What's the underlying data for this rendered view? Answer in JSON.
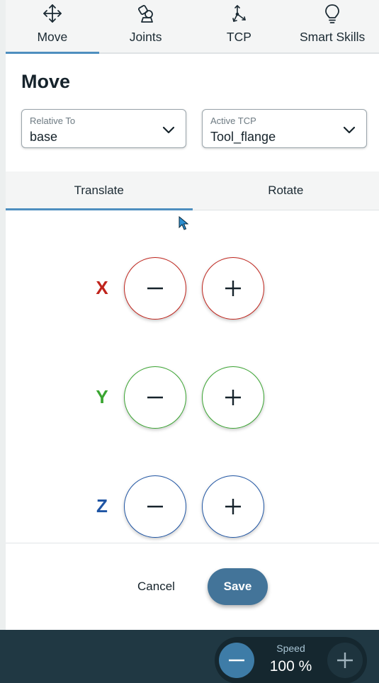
{
  "nav_tabs": [
    {
      "label": "Move",
      "icon": "move-arrows-icon",
      "active": true
    },
    {
      "label": "Joints",
      "icon": "robot-joint-icon",
      "active": false
    },
    {
      "label": "TCP",
      "icon": "tcp-axes-icon",
      "active": false
    },
    {
      "label": "Smart Skills",
      "icon": "lightbulb-icon",
      "active": false
    }
  ],
  "page": {
    "title": "Move"
  },
  "relative_to": {
    "caption": "Relative To",
    "value": "base"
  },
  "active_tcp": {
    "caption": "Active TCP",
    "value": "Tool_flange"
  },
  "mode_tabs": [
    {
      "label": "Translate",
      "active": true
    },
    {
      "label": "Rotate",
      "active": false
    }
  ],
  "axes": [
    {
      "label": "X",
      "color": "#c0241c"
    },
    {
      "label": "Y",
      "color": "#3aa531"
    },
    {
      "label": "Z",
      "color": "#1f55a4"
    }
  ],
  "actions": {
    "cancel_label": "Cancel",
    "save_label": "Save"
  },
  "speed": {
    "caption": "Speed",
    "value": "100 %"
  },
  "colors": {
    "accent": "#4e8fbf",
    "save_button": "#437499",
    "bottom_bar": "#203843"
  }
}
